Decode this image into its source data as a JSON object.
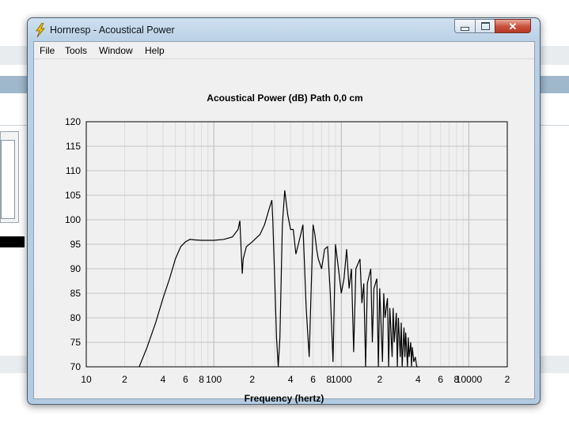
{
  "window": {
    "title": "Hornresp - Acoustical Power",
    "minimize_glyph": "",
    "close_glyph": "✕"
  },
  "menu": [
    {
      "label": "File"
    },
    {
      "label": "Tools"
    },
    {
      "label": "Window"
    },
    {
      "label": "Help"
    }
  ],
  "chart_data": {
    "type": "line",
    "title": "Acoustical Power (dB)   Path 0,0 cm",
    "xlabel": "Frequency (hertz)",
    "ylabel": "",
    "x_scale": "log",
    "xlim": [
      10,
      20000
    ],
    "ylim": [
      70,
      120
    ],
    "grid": true,
    "y_ticks": [
      "120",
      "115",
      "110",
      "105",
      "100",
      "95",
      "90",
      "85",
      "80",
      "75",
      "70"
    ],
    "x_ticks": [
      {
        "value": 10,
        "label": "10"
      },
      {
        "value": 20,
        "label": "2"
      },
      {
        "value": 40,
        "label": "4"
      },
      {
        "value": 60,
        "label": "6"
      },
      {
        "value": 80,
        "label": "8"
      },
      {
        "value": 100,
        "label": "100"
      },
      {
        "value": 200,
        "label": "2"
      },
      {
        "value": 400,
        "label": "4"
      },
      {
        "value": 600,
        "label": "6"
      },
      {
        "value": 800,
        "label": "8"
      },
      {
        "value": 1000,
        "label": "1000"
      },
      {
        "value": 2000,
        "label": "2"
      },
      {
        "value": 4000,
        "label": "4"
      },
      {
        "value": 6000,
        "label": "6"
      },
      {
        "value": 8000,
        "label": "8"
      },
      {
        "value": 10000,
        "label": "10000"
      },
      {
        "value": 20000,
        "label": "2"
      }
    ],
    "series": [
      {
        "x": [
          26,
          30,
          35,
          40,
          45,
          50,
          55,
          60,
          65,
          70,
          80,
          100,
          120,
          140,
          155,
          160,
          163,
          167,
          170,
          180,
          200,
          230,
          250,
          270,
          285,
          290,
          300,
          310,
          320,
          330,
          345,
          360,
          380,
          400,
          420,
          440,
          460,
          480,
          500,
          530,
          560,
          600,
          620,
          640,
          660,
          700,
          740,
          780,
          820,
          860,
          900,
          950,
          1000,
          1050,
          1100,
          1150,
          1200,
          1250,
          1300,
          1400,
          1450,
          1500,
          1550,
          1600,
          1700,
          1750,
          1800,
          1900,
          1950,
          2000,
          2100,
          2150,
          2200,
          2300,
          2350,
          2400,
          2500,
          2550,
          2600,
          2700,
          2750,
          2800,
          2900,
          2950,
          3000,
          3100,
          3150,
          3200,
          3300,
          3350,
          3400,
          3500,
          3550,
          3600,
          3700,
          3800,
          3900,
          4000
        ],
        "y": [
          70,
          74,
          79,
          84,
          88,
          92,
          94.5,
          95.5,
          96,
          95.9,
          95.8,
          95.8,
          96,
          96.5,
          98,
          99.8,
          95,
          89,
          92,
          94.5,
          95.5,
          97,
          99,
          102,
          104,
          100,
          88,
          76,
          70,
          76,
          99,
          106,
          101,
          98,
          98,
          93,
          95,
          97,
          99,
          82,
          72,
          99,
          97,
          94,
          92,
          90,
          94,
          94.5,
          85,
          71,
          95,
          90,
          85,
          88,
          94,
          86,
          90,
          73,
          90,
          92,
          83,
          87,
          70,
          87,
          90,
          75,
          86,
          88,
          70,
          86,
          71,
          85,
          80,
          84,
          70,
          82,
          72,
          82,
          75,
          81,
          70,
          80,
          72,
          79,
          70,
          78,
          72,
          77,
          70,
          76,
          72,
          75,
          70,
          74,
          71,
          72,
          70,
          70
        ]
      }
    ]
  }
}
